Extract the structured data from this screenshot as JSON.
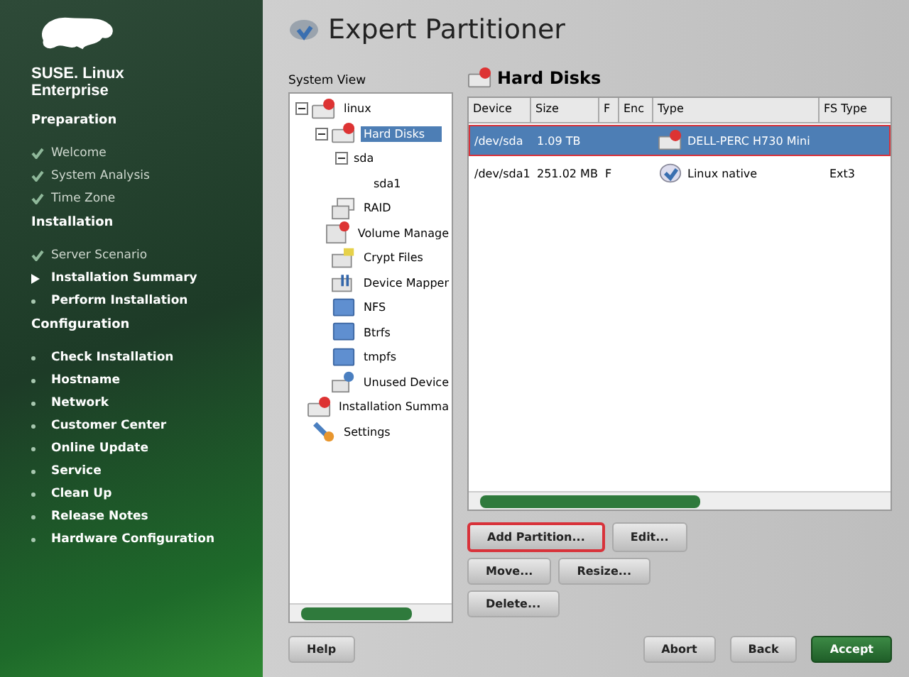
{
  "sidebar": {
    "brand": "SUSE. Linux Enterprise",
    "sections": [
      {
        "title": "Preparation",
        "items": [
          {
            "label": "Welcome",
            "kind": "done"
          },
          {
            "label": "System Analysis",
            "kind": "done"
          },
          {
            "label": "Time Zone",
            "kind": "done"
          }
        ]
      },
      {
        "title": "Installation",
        "items": [
          {
            "label": "Server Scenario",
            "kind": "done"
          },
          {
            "label": "Installation Summary",
            "kind": "current"
          },
          {
            "label": "Perform Installation",
            "kind": "pending"
          }
        ]
      },
      {
        "title": "Configuration",
        "items": [
          {
            "label": "Check Installation",
            "kind": "pending"
          },
          {
            "label": "Hostname",
            "kind": "pending"
          },
          {
            "label": "Network",
            "kind": "pending"
          },
          {
            "label": "Customer Center",
            "kind": "pending"
          },
          {
            "label": "Online Update",
            "kind": "pending"
          },
          {
            "label": "Service",
            "kind": "pending"
          },
          {
            "label": "Clean Up",
            "kind": "pending"
          },
          {
            "label": "Release Notes",
            "kind": "pending"
          },
          {
            "label": "Hardware Configuration",
            "kind": "pending"
          }
        ]
      }
    ]
  },
  "window": {
    "title": "Expert Partitioner"
  },
  "system_view": {
    "label": "System View",
    "tree": [
      {
        "label": "linux",
        "kind": "disk",
        "selected": false,
        "expanded": true,
        "children": [
          {
            "label": "Hard Disks",
            "kind": "disk",
            "selected": true,
            "expanded": true,
            "children": [
              {
                "label": "sda",
                "selected": false,
                "expanded": true,
                "children": [
                  {
                    "label": "sda1",
                    "selected": false
                  }
                ]
              }
            ]
          },
          {
            "label": "RAID",
            "kind": "raid",
            "selected": false
          },
          {
            "label": "Volume Manage",
            "kind": "volume",
            "selected": false
          },
          {
            "label": "Crypt Files",
            "kind": "crypt",
            "selected": false
          },
          {
            "label": "Device Mapper",
            "kind": "mapper",
            "selected": false
          },
          {
            "label": "NFS",
            "kind": "folder",
            "selected": false
          },
          {
            "label": "Btrfs",
            "kind": "folder",
            "selected": false
          },
          {
            "label": "tmpfs",
            "kind": "folder",
            "selected": false
          },
          {
            "label": "Unused Device",
            "kind": "unused",
            "selected": false
          }
        ]
      },
      {
        "label": "Installation Summa",
        "kind": "disk",
        "selected": false
      },
      {
        "label": "Settings",
        "kind": "settings",
        "selected": false
      }
    ]
  },
  "hard_disks": {
    "title": "Hard Disks",
    "columns": [
      "Device",
      "Size",
      "F",
      "Enc",
      "Type",
      "FS Type"
    ],
    "rows": [
      {
        "cells": [
          "/dev/sda",
          "1.09 TB",
          "",
          "",
          "DELL-PERC H730 Mini",
          ""
        ],
        "kind": "disk",
        "selected": true,
        "highlighted": true
      },
      {
        "cells": [
          "/dev/sda1",
          "251.02 MB",
          "F",
          "",
          "Linux native",
          "Ext3"
        ],
        "kind": "partition",
        "selected": false,
        "highlighted": false
      }
    ]
  },
  "actions": [
    [
      {
        "label": "Add Partition...",
        "highlighted": true
      },
      {
        "label": "Edit...",
        "highlighted": false
      }
    ],
    [
      {
        "label": "Move...",
        "highlighted": false
      },
      {
        "label": "Resize...",
        "highlighted": false
      }
    ],
    [
      {
        "label": "Delete...",
        "highlighted": false
      }
    ]
  ],
  "footer": {
    "help": "Help",
    "abort": "Abort",
    "back": "Back",
    "accept": "Accept"
  }
}
